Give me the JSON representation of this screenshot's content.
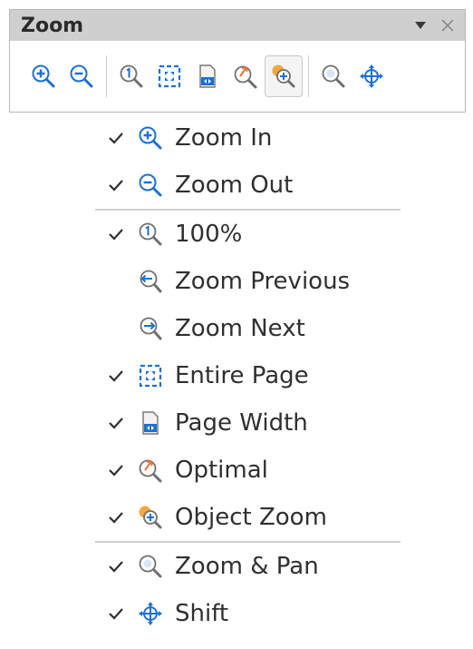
{
  "toolbar": {
    "title": "Zoom",
    "buttons": [
      {
        "name": "zoom-in",
        "icon": "zoom-in-icon",
        "active": false
      },
      {
        "name": "zoom-out",
        "icon": "zoom-out-icon",
        "active": false
      },
      {
        "name": "zoom-100",
        "icon": "zoom-100-icon",
        "active": false
      },
      {
        "name": "entire-page",
        "icon": "entire-page-icon",
        "active": false
      },
      {
        "name": "page-width",
        "icon": "page-width-icon",
        "active": false
      },
      {
        "name": "optimal",
        "icon": "optimal-icon",
        "active": false
      },
      {
        "name": "object-zoom",
        "icon": "object-zoom-icon",
        "active": true
      },
      {
        "name": "zoom-pan",
        "icon": "zoom-pan-icon",
        "active": false
      },
      {
        "name": "shift",
        "icon": "shift-icon",
        "active": false
      }
    ]
  },
  "menu": {
    "items": [
      {
        "label": "Zoom In",
        "checked": true,
        "icon": "zoom-in-icon"
      },
      {
        "label": "Zoom Out",
        "checked": true,
        "icon": "zoom-out-icon"
      },
      {
        "label": "100%",
        "checked": true,
        "icon": "zoom-100-icon"
      },
      {
        "label": "Zoom Previous",
        "checked": false,
        "icon": "zoom-previous-icon"
      },
      {
        "label": "Zoom Next",
        "checked": false,
        "icon": "zoom-next-icon"
      },
      {
        "label": "Entire Page",
        "checked": true,
        "icon": "entire-page-icon"
      },
      {
        "label": "Page Width",
        "checked": true,
        "icon": "page-width-icon"
      },
      {
        "label": "Optimal",
        "checked": true,
        "icon": "optimal-icon"
      },
      {
        "label": "Object Zoom",
        "checked": true,
        "icon": "object-zoom-icon"
      },
      {
        "label": "Zoom & Pan",
        "checked": true,
        "icon": "zoom-pan-icon"
      },
      {
        "label": "Shift",
        "checked": true,
        "icon": "shift-icon"
      }
    ]
  },
  "colors": {
    "accent_blue": "#1e6fd0",
    "icon_gray": "#6f6f6f",
    "icon_orange": "#e8a03c",
    "titlebar": "#cfcfcf"
  }
}
